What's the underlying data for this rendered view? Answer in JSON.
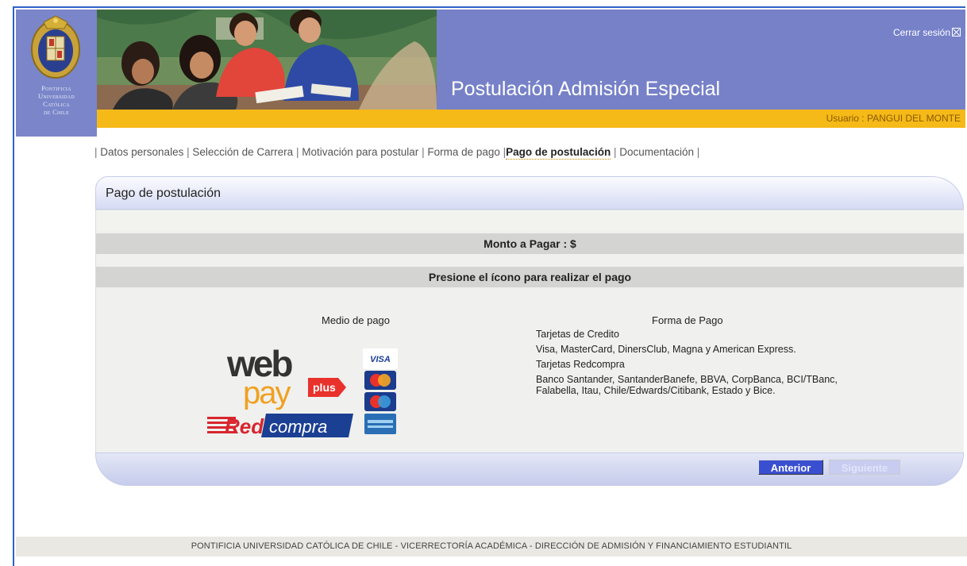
{
  "header": {
    "logout_label": "Cerrar sesión",
    "site_title": "Postulación Admisión Especial",
    "user_label": "Usuario : ",
    "user_name": "PANGUI DEL MONTE",
    "university_name": [
      "Pontificia",
      "Universidad",
      "Católica",
      "de Chile"
    ]
  },
  "nav": {
    "items": [
      "Datos personales",
      "Selección de Carrera",
      "Motivación para postular",
      "Forma de pago",
      "Pago de postulación",
      "Documentación"
    ],
    "active": "Pago de postulación"
  },
  "panel": {
    "title": "Pago de postulación",
    "amount_label": "Monto a Pagar : $",
    "instruction": "Presione el ícono para realizar el pago",
    "medio_header": "Medio de pago",
    "forma_header": "Forma de Pago",
    "forma_lines": [
      "Tarjetas de Credito",
      "Visa, MasterCard, DinersClub, Magna y American Express.",
      "Tarjetas Redcompra",
      "Banco Santander, SantanderBanefe, BBVA, CorpBanca, BCI/TBanc, Falabella, Itau, Chile/Edwards/Citibank, Estado y Bice."
    ],
    "logos": {
      "webpay_text": "web",
      "webpay_pay": "pay",
      "webpay_plus": "plus",
      "redcompra_red": "Red",
      "redcompra_compra": "compra",
      "visa": "VISA"
    },
    "prev_button": "Anterior",
    "next_button": "Siguiente"
  },
  "footer": {
    "text": "PONTIFICIA UNIVERSIDAD CATÓLICA DE CHILE - VICERRECTORÍA ACADÉMICA - DIRECCIÓN DE ADMISIÓN Y FINANCIAMIENTO ESTUDIANTIL"
  },
  "colors": {
    "header_blue": "#7681c8",
    "gold": "#f5b918",
    "button_blue": "#3a4fd0"
  }
}
